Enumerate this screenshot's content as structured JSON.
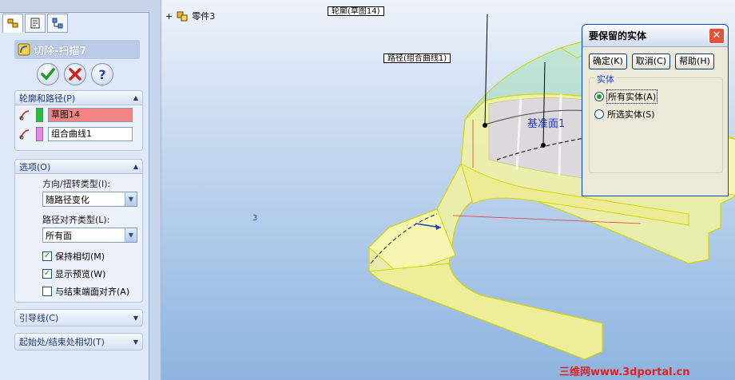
{
  "feature": {
    "title": "切除-扫描7"
  },
  "groups": {
    "profile_path": {
      "header": "轮廓和路径(P)",
      "profile_value": "草图14",
      "path_value": "组合曲线1",
      "profile_color": "#1fbf3a",
      "path_color": "#e988e6"
    },
    "options": {
      "header": "选项(O)",
      "orient_label": "方向/扭转类型(I):",
      "orient_value": "随路径变化",
      "align_label": "路径对齐类型(L):",
      "align_value": "所有面",
      "checkboxes": [
        {
          "label": "保持相切(M)",
          "checked": true
        },
        {
          "label": "显示预览(W)",
          "checked": true
        },
        {
          "label": "与结束端面对齐(A)",
          "checked": false
        }
      ]
    },
    "guide": {
      "header": "引导线(C)"
    },
    "tangency": {
      "header": "起始处/结束处相切(T)"
    }
  },
  "viewport": {
    "tree_expander": "+",
    "tree_item": "零件3",
    "callout_profile": "轮廓(草图14)",
    "callout_path": "路径(组合曲线1)",
    "plane_label": "基准面1",
    "triad_label": "3"
  },
  "dialog": {
    "title": "要保留的实体",
    "buttons": {
      "ok": "确定(K)",
      "cancel": "取消(C)",
      "help": "帮助(H)"
    },
    "group_label": "实体",
    "options": [
      {
        "label": "所有实体(A)",
        "selected": true
      },
      {
        "label": "所选实体(S)",
        "selected": false
      }
    ]
  },
  "watermark": "三维网www.3dportal.cn",
  "colors": {
    "body_fill": "#f3f3a0",
    "body_edge": "#d4d400",
    "preview_fill": "#a8e0b8",
    "dialog_close": "#e0533c"
  }
}
